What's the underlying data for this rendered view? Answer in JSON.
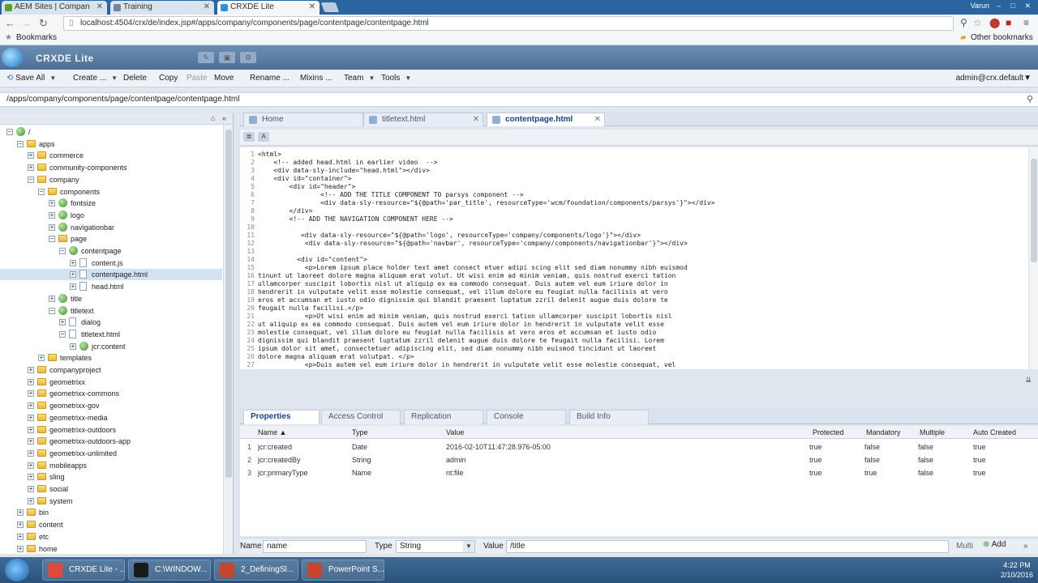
{
  "browser": {
    "tabs": [
      {
        "label": "AEM Sites | Compan",
        "fav_color": "#5aa02c"
      },
      {
        "label": "Training",
        "fav_color": "#6f87a3"
      },
      {
        "label": "CRXDE Lite",
        "fav_color": "#2f8fd8"
      }
    ],
    "user": "Varun",
    "url": "localhost:4504/crx/de/index.jsp#/apps/company/components/page/contentpage/contentpage.html",
    "bookmarks_label": "Bookmarks",
    "other_bookmarks_label": "Other bookmarks"
  },
  "app": {
    "title": "CRXDE Lite"
  },
  "toolbar": {
    "save_all": "Save All",
    "create": "Create ...",
    "delete": "Delete",
    "copy": "Copy",
    "paste": "Paste",
    "move": "Move",
    "rename": "Rename ...",
    "mixins": "Mixins ...",
    "team": "Team",
    "tools": "Tools",
    "user": "admin@crx.default"
  },
  "path": "/apps/company/components/page/contentpage/contentpage.html",
  "tree": {
    "root": "/",
    "items": [
      {
        "label": "apps",
        "level": 1,
        "icon": "folder",
        "open": true
      },
      {
        "label": "commerce",
        "level": 2,
        "icon": "folder",
        "open": false
      },
      {
        "label": "community-components",
        "level": 2,
        "icon": "folder",
        "open": false
      },
      {
        "label": "company",
        "level": 2,
        "icon": "folder",
        "open": true
      },
      {
        "label": "components",
        "level": 3,
        "icon": "folder",
        "open": true
      },
      {
        "label": "fontsize",
        "level": 4,
        "icon": "component",
        "open": false
      },
      {
        "label": "logo",
        "level": 4,
        "icon": "component",
        "open": false
      },
      {
        "label": "navigationbar",
        "level": 4,
        "icon": "component",
        "open": false
      },
      {
        "label": "page",
        "level": 4,
        "icon": "folder",
        "open": true
      },
      {
        "label": "contentpage",
        "level": 5,
        "icon": "component",
        "open": true
      },
      {
        "label": "content.js",
        "level": 6,
        "icon": "file",
        "open": false
      },
      {
        "label": "contentpage.html",
        "level": 6,
        "icon": "file",
        "open": false,
        "selected": true
      },
      {
        "label": "head.html",
        "level": 6,
        "icon": "file",
        "open": false
      },
      {
        "label": "title",
        "level": 4,
        "icon": "component",
        "open": false
      },
      {
        "label": "titletext",
        "level": 4,
        "icon": "component",
        "open": true
      },
      {
        "label": "dialog",
        "level": 5,
        "icon": "file",
        "open": false
      },
      {
        "label": "titletext.html",
        "level": 5,
        "icon": "file",
        "open": true
      },
      {
        "label": "jcr:content",
        "level": 6,
        "icon": "component",
        "open": false
      },
      {
        "label": "templates",
        "level": 3,
        "icon": "folder",
        "open": false
      },
      {
        "label": "companyproject",
        "level": 2,
        "icon": "folder",
        "open": false
      },
      {
        "label": "geometrixx",
        "level": 2,
        "icon": "folder",
        "open": false
      },
      {
        "label": "geometrixx-commons",
        "level": 2,
        "icon": "folder",
        "open": false
      },
      {
        "label": "geometrixx-gov",
        "level": 2,
        "icon": "folder",
        "open": false
      },
      {
        "label": "geometrixx-media",
        "level": 2,
        "icon": "folder",
        "open": false
      },
      {
        "label": "geometrixx-outdoors",
        "level": 2,
        "icon": "folder",
        "open": false
      },
      {
        "label": "geometrixx-outdoors-app",
        "level": 2,
        "icon": "folder",
        "open": false
      },
      {
        "label": "geometrixx-unlimited",
        "level": 2,
        "icon": "folder",
        "open": false
      },
      {
        "label": "mobileapps",
        "level": 2,
        "icon": "folder",
        "open": false
      },
      {
        "label": "sling",
        "level": 2,
        "icon": "folder",
        "open": false
      },
      {
        "label": "social",
        "level": 2,
        "icon": "folder",
        "open": false
      },
      {
        "label": "system",
        "level": 2,
        "icon": "folder",
        "open": false
      },
      {
        "label": "bin",
        "level": 1,
        "icon": "folder",
        "open": false
      },
      {
        "label": "content",
        "level": 1,
        "icon": "folder",
        "open": false
      },
      {
        "label": "etc",
        "level": 1,
        "icon": "folder",
        "open": false
      },
      {
        "label": "home",
        "level": 1,
        "icon": "folder",
        "open": false
      }
    ]
  },
  "editor": {
    "tabs": [
      {
        "label": "Home",
        "active": false,
        "closable": false
      },
      {
        "label": "titletext.html",
        "active": false,
        "closable": true
      },
      {
        "label": "contentpage.html",
        "active": true,
        "closable": true
      }
    ],
    "lines": [
      "<html>",
      "    <!-- added head.html in earlier video  -->",
      "    <div data-sly-include=\"head.html\"></div>",
      "    <div id=\"container\">",
      "        <div id=\"header\">",
      "                <!-- ADD THE TITLE COMPONENT TO parsys component -->",
      "                <div data-sly-resource=\"${@path='par_title', resourceType='wcm/foundation/components/parsys'}\"></div>",
      "        </div>",
      "        <!-- ADD THE NAVIGATION COMPONENT HERE -->",
      "",
      "           <div data-sly-resource=\"${@path='logo', resourceType='company/components/logo'}\"></div>",
      "            <div data-sly-resource=\"${@path='navbar', resourceType='company/components/navigationbar'}\"></div>",
      "",
      "          <div id=\"content\">",
      "            <p>Lorem ipsum place holder text amet consect etuer adipi scing elit sed diam nonummy nibh euismod",
      "tinunt ut laoreet dolore magna aliquam erat volut. Ut wisi enim ad minim veniam, quis nostrud exerci tation",
      "ullamcorper suscipit lobortis nisl ut aliquip ex ea commodo consequat. Duis autem vel eum iriure dolor in",
      "hendrerit in vulputate velit esse molestie consequat, vel illum dolore eu feugiat nulla facilisis at vero",
      "eros et accumsan et iusto odio dignissim qui blandit praesent luptatum zzril delenit augue duis dolore te",
      "feugait nulla facilisi.</p>",
      "            <p>Ut wisi enim ad minim veniam, quis nostrud exerci tation ullamcorper suscipit lobortis nisl",
      "ut aliquip ex ea commodo consequat. Duis autem vel eum iriure dolor in hendrerit in vulputate velit esse",
      "molestie consequat, vel illum dolore eu feugiat nulla facilisis at vero eros et accumsan et iusto odio",
      "dignissim qui blandit praesent luptatum zzril delenit augue duis dolore te feugait nulla facilisi. Lorem",
      "ipsum dolor sit amet, consectetuer adipiscing elit, sed diam nonummy nibh euismod tincidunt ut laoreet",
      "dolore magna aliquam erat volutpat. </p>",
      "            <p>Duis autem vel eum iriure dolor in hendrerit in vulputate velit esse molestie consequat, vel"
    ]
  },
  "bottom": {
    "tabs": [
      {
        "label": "Properties",
        "active": true
      },
      {
        "label": "Access Control",
        "active": false
      },
      {
        "label": "Replication",
        "active": false
      },
      {
        "label": "Console",
        "active": false
      },
      {
        "label": "Build Info",
        "active": false
      }
    ],
    "columns": [
      "Name ▲",
      "Type",
      "Value",
      "Protected",
      "Mandatory",
      "Multiple",
      "Auto Created"
    ],
    "rows": [
      {
        "num": "1",
        "name": "jcr:created",
        "type": "Date",
        "value": "2016-02-10T11:47:28.976-05:00",
        "protected": "true",
        "mandatory": "false",
        "multiple": "false",
        "auto": "true"
      },
      {
        "num": "2",
        "name": "jcr:createdBy",
        "type": "String",
        "value": "admin",
        "protected": "true",
        "mandatory": "false",
        "multiple": "false",
        "auto": "true"
      },
      {
        "num": "3",
        "name": "jcr:primaryType",
        "type": "Name",
        "value": "nt:file",
        "protected": "true",
        "mandatory": "true",
        "multiple": "false",
        "auto": "true"
      }
    ],
    "editor": {
      "name_label": "Name",
      "name_value": "name",
      "type_label": "Type",
      "type_value": "String",
      "value_label": "Value",
      "value_value": "/title",
      "multi_label": "Multi",
      "add_label": "Add"
    }
  },
  "taskbar": {
    "items": [
      {
        "label": "CRXDE Lite - ...",
        "color": "#e04a3a"
      },
      {
        "label": "C:\\WINDOW...",
        "color": "#1a1a1a"
      },
      {
        "label": "2_DefiningSl...",
        "color": "#c8442c"
      },
      {
        "label": "PowerPoint S...",
        "color": "#c8442c"
      }
    ],
    "time": "4:22 PM",
    "date": "2/10/2016"
  },
  "colors": {
    "accent_blue": "#15428b",
    "selection": "#d4e3f3"
  }
}
